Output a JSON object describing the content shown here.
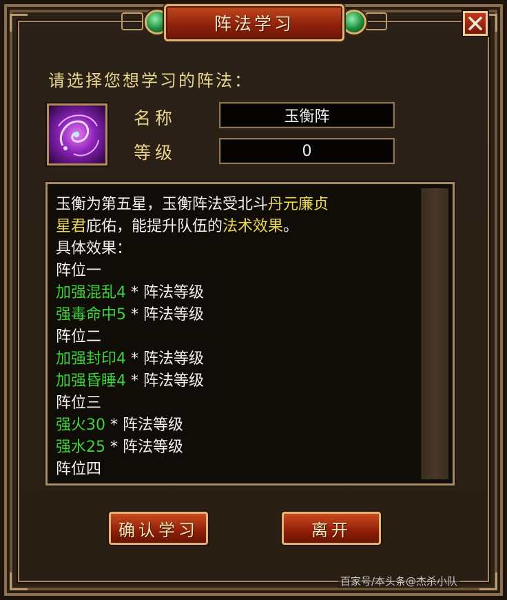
{
  "window": {
    "title": "阵法学习",
    "close_icon": "close-icon"
  },
  "form": {
    "prompt": "请选择您想学习的阵法：",
    "name_label": "名称",
    "name_value": "玉衡阵",
    "level_label": "等级",
    "level_value": "0",
    "formation_icon": "purple-swirl-icon"
  },
  "description": {
    "intro_1a": "玉衡为第五星，玉衡阵法受北斗",
    "intro_1b": "丹元廉贞",
    "intro_2a": "星君",
    "intro_2b": "庇佑，能提升队伍的",
    "intro_2c": "法术效果",
    "intro_2d": "。",
    "effects_header": "具体效果：",
    "positions": [
      {
        "title": "阵位一",
        "effects": [
          {
            "effect": "加强混乱4",
            "suffix": " * 阵法等级"
          },
          {
            "effect": "强毒命中5",
            "suffix": " * 阵法等级"
          }
        ]
      },
      {
        "title": "阵位二",
        "effects": [
          {
            "effect": "加强封印4",
            "suffix": " * 阵法等级"
          },
          {
            "effect": "加强昏睡4",
            "suffix": " * 阵法等级"
          }
        ]
      },
      {
        "title": "阵位三",
        "effects": [
          {
            "effect": "强火30",
            "suffix": " * 阵法等级"
          },
          {
            "effect": "强水25",
            "suffix": " * 阵法等级"
          }
        ]
      },
      {
        "title": "阵位四",
        "effects": []
      }
    ]
  },
  "buttons": {
    "confirm": "确认学习",
    "leave": "离开"
  },
  "watermark": "百家号/本头条@杰杀小队",
  "colors": {
    "highlight_yellow": "#ecd94b",
    "effect_green": "#3fd23c",
    "label_gold": "#e9d68c",
    "button_red": "#8a1c08"
  }
}
